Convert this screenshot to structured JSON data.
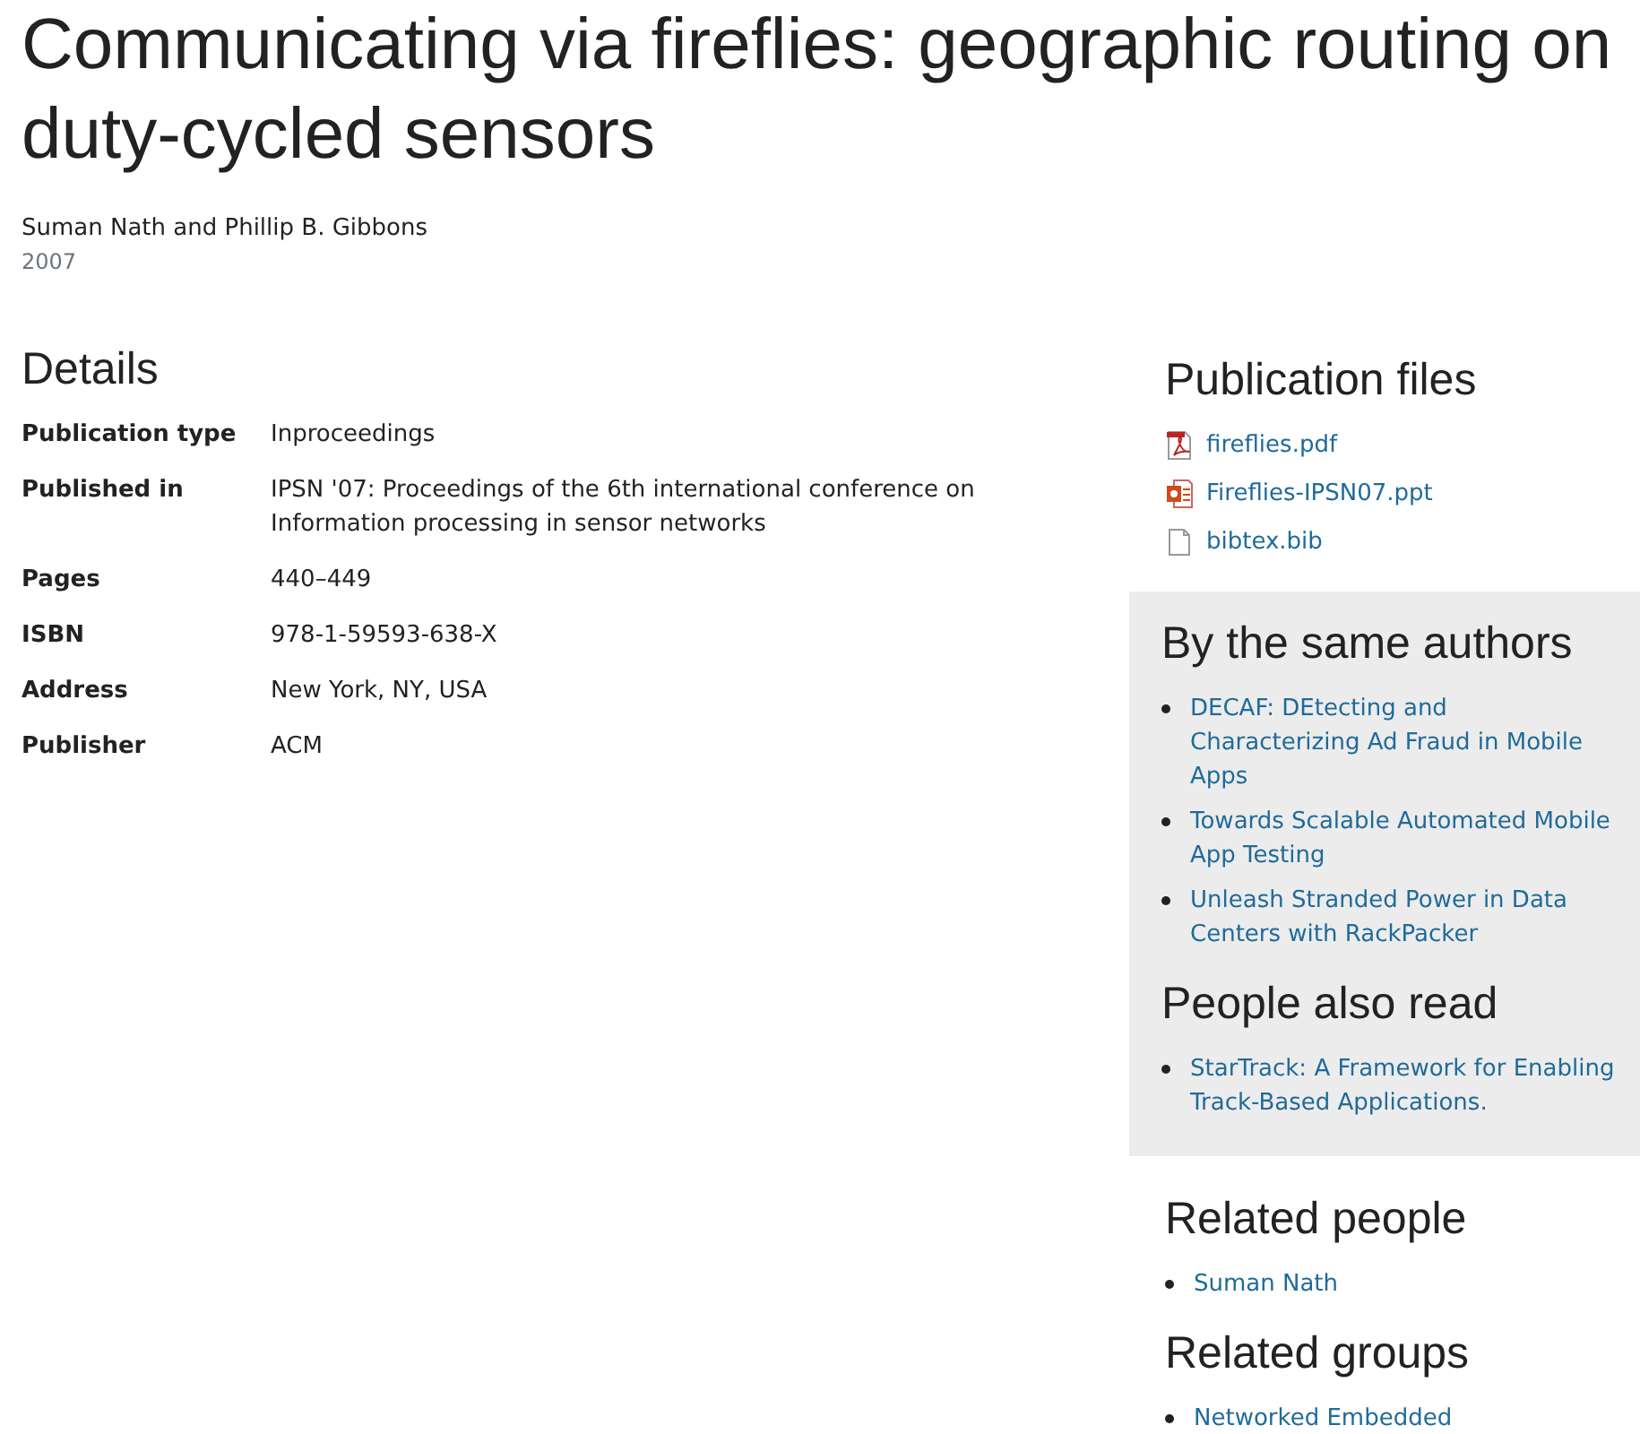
{
  "title": "Communicating via fireflies: geographic routing on duty-cycled sensors",
  "authors": "Suman Nath and Phillip B. Gibbons",
  "year": "2007",
  "details": {
    "heading": "Details",
    "rows": [
      {
        "label": "Publication type",
        "value": "Inproceedings"
      },
      {
        "label": "Published in",
        "value": "IPSN '07: Proceedings of the 6th international conference on Information processing in sensor networks"
      },
      {
        "label": "Pages",
        "value": "440–449"
      },
      {
        "label": "ISBN",
        "value": "978-1-59593-638-X"
      },
      {
        "label": "Address",
        "value": "New York, NY, USA"
      },
      {
        "label": "Publisher",
        "value": "ACM"
      }
    ]
  },
  "publication_files": {
    "heading": "Publication files",
    "files": [
      {
        "name": "fireflies.pdf",
        "kind": "pdf"
      },
      {
        "name": "Fireflies-IPSN07.ppt",
        "kind": "ppt"
      },
      {
        "name": "bibtex.bib",
        "kind": "file"
      }
    ]
  },
  "sidebar_panel": [
    {
      "heading": "By the same authors",
      "links": [
        "DECAF: DEtecting and Characterizing Ad Fraud in Mobile Apps",
        "Towards Scalable Automated Mobile App Testing",
        "Unleash Stranded Power in Data Centers with RackPacker"
      ]
    },
    {
      "heading": "People also read",
      "links": [
        "StarTrack: A Framework for Enabling Track-Based Applications."
      ]
    }
  ],
  "related": [
    {
      "heading": "Related people",
      "links": [
        "Suman Nath"
      ]
    },
    {
      "heading": "Related groups",
      "links": [
        "Networked Embedded"
      ]
    }
  ]
}
